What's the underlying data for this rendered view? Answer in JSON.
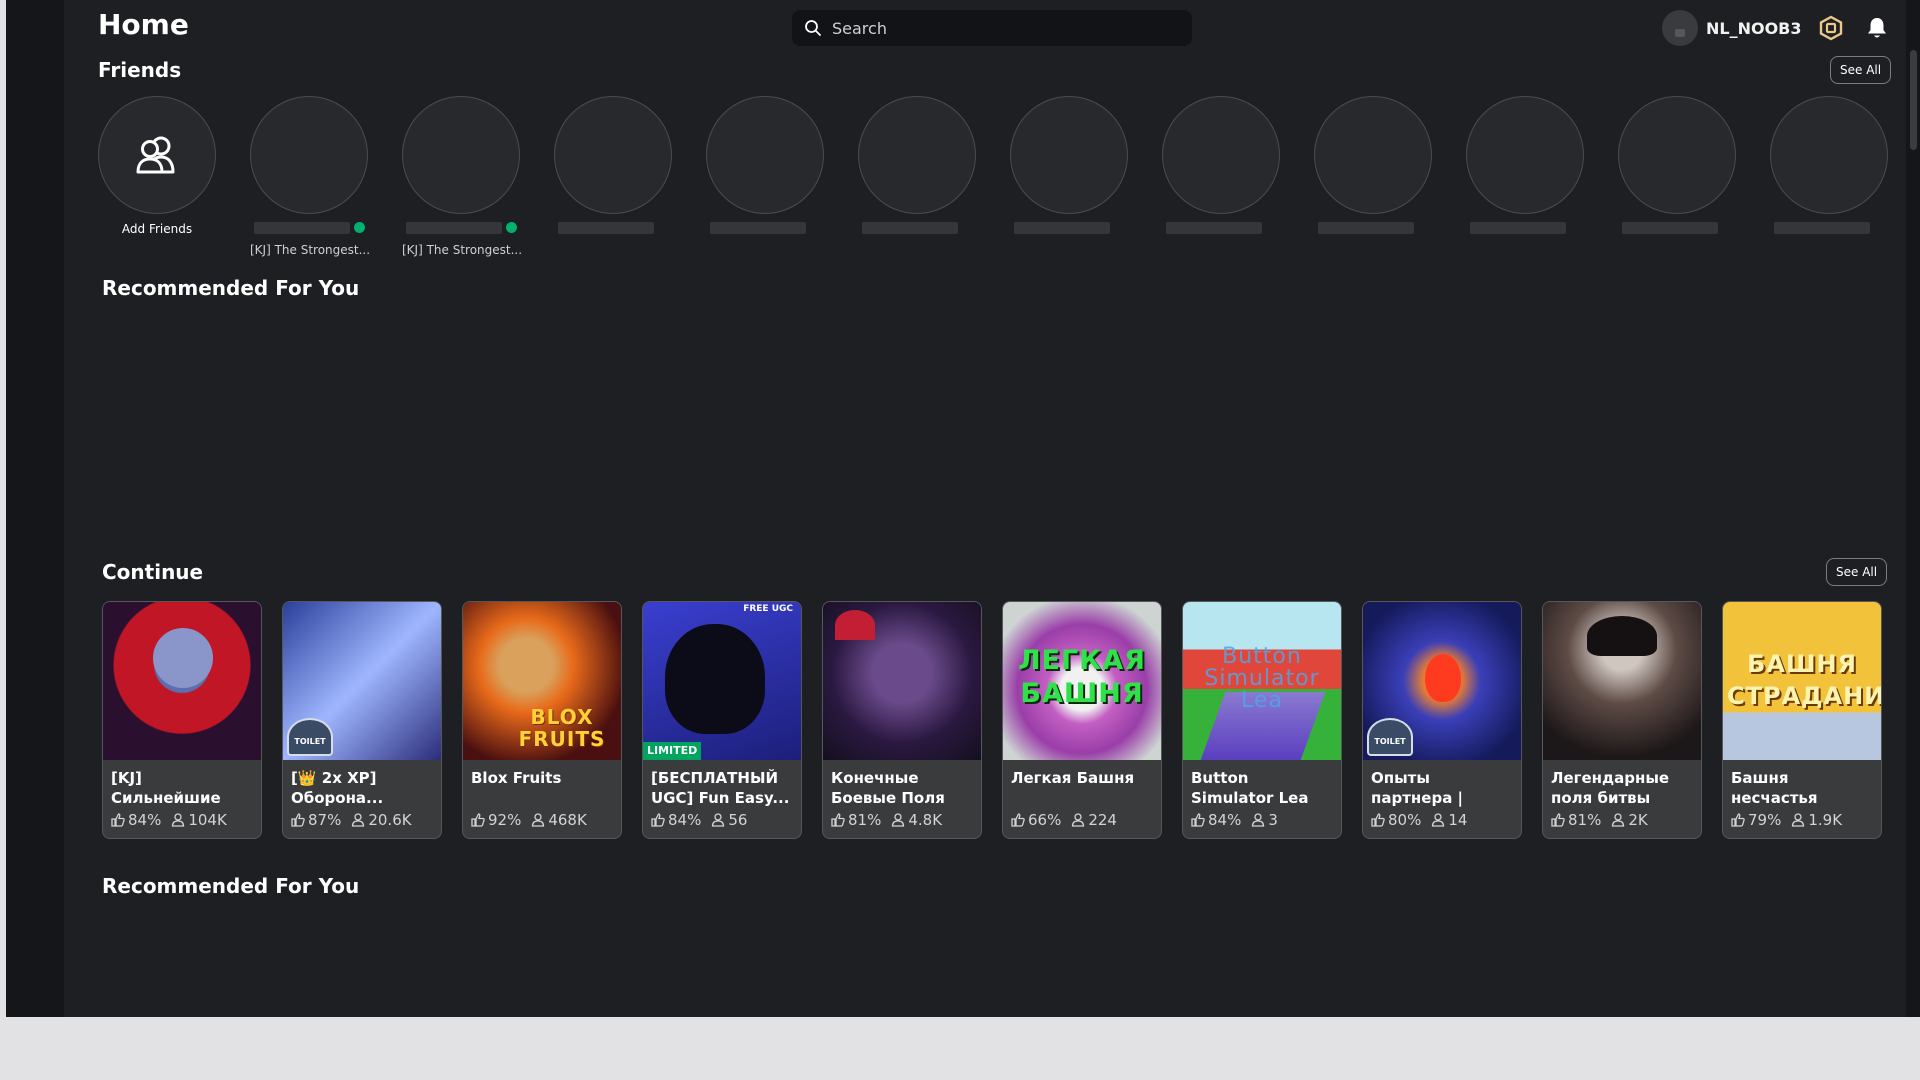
{
  "header": {
    "title": "Home",
    "search_placeholder": "Search",
    "username": "NL_NOOB3"
  },
  "icons": {
    "search": "search-icon",
    "robux": "robux-icon",
    "notifications": "bell-icon",
    "add_friends": "add-friends-icon",
    "thumbs_up": "thumbs-up-icon",
    "players": "players-icon"
  },
  "colors": {
    "background": "#1e1f22",
    "card": "#393b3d",
    "online": "#00b06f",
    "limited": "#00a45e"
  },
  "friends": {
    "title": "Friends",
    "see_all": "See All",
    "add_label": "Add Friends",
    "items": [
      {
        "game": "[KJ] The Strongest...",
        "online": true
      },
      {
        "game": "[KJ] The Strongest...",
        "online": true
      },
      {
        "game": "",
        "online": false
      },
      {
        "game": "",
        "online": false
      },
      {
        "game": "",
        "online": false
      },
      {
        "game": "",
        "online": false
      },
      {
        "game": "",
        "online": false
      },
      {
        "game": "",
        "online": false
      },
      {
        "game": "",
        "online": false
      },
      {
        "game": "",
        "online": false
      }
    ]
  },
  "sections": {
    "recommended_1": "Recommended For You",
    "continue": "Continue",
    "continue_see_all": "See All",
    "recommended_2": "Recommended For You"
  },
  "games": [
    {
      "title": "[KJ] Сильнейшие поля битвы",
      "rating": "84%",
      "players": "104K"
    },
    {
      "title": "[👑 2x XP] Оборона...",
      "rating": "87%",
      "players": "20.6K"
    },
    {
      "title": "Blox Fruits",
      "rating": "92%",
      "players": "468K",
      "thumb_text": "BLOX FRUITS"
    },
    {
      "title": "[БЕСПЛАТНЫЙ UGC] Fun Easy...",
      "rating": "84%",
      "players": "56",
      "badge": "LIMITED",
      "corner": "FREE UGC"
    },
    {
      "title": "Конечные Боевые Поля",
      "rating": "81%",
      "players": "4.8K"
    },
    {
      "title": "Легкая Башня",
      "rating": "66%",
      "players": "224",
      "thumb_text": "ЛЕГКАЯ БАШНЯ"
    },
    {
      "title": "Button Simulator Lea",
      "rating": "84%",
      "players": "3",
      "thumb_text": "Button Simulator Lea"
    },
    {
      "title": "Опыты партнера | Защита башни в...",
      "rating": "80%",
      "players": "14"
    },
    {
      "title": "Легендарные поля битвы",
      "rating": "81%",
      "players": "2K"
    },
    {
      "title": "Башня несчастья",
      "rating": "79%",
      "players": "1.9K",
      "thumb_text": "БАШНЯ СТРАДАНИЙ"
    }
  ],
  "logos": {
    "toilet": "TOILET"
  }
}
